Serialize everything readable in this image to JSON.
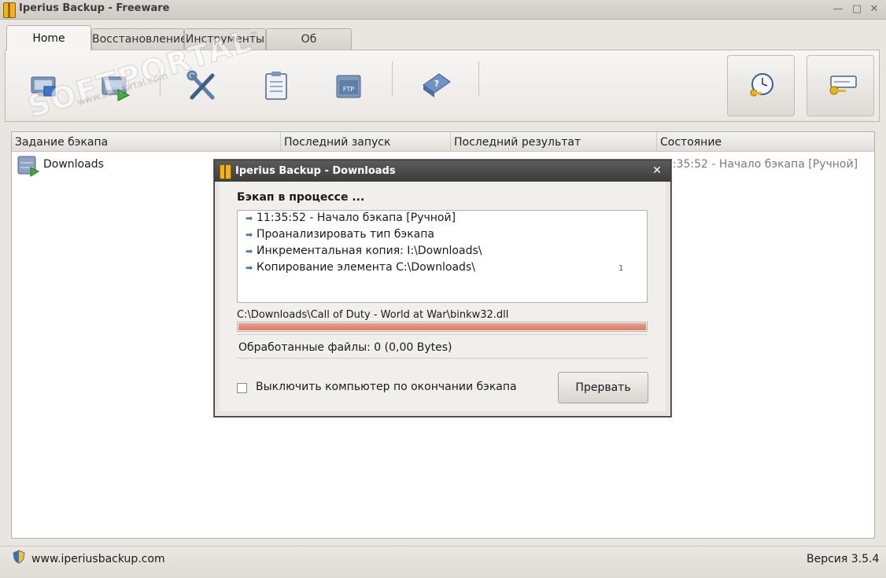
{
  "window": {
    "title": "Iperius Backup - Freeware",
    "minimize": "—",
    "maximize": "□",
    "close": "✕"
  },
  "tabs": [
    {
      "label": "Home"
    },
    {
      "label": "Восстановление"
    },
    {
      "label": "Инструменты"
    },
    {
      "label": "Об"
    }
  ],
  "ribbon": {
    "icons": [
      "new-backup-icon",
      "run-backup-icon",
      "tools-icon",
      "clipboard-icon",
      "ftp-icon",
      "help-book-icon"
    ],
    "ftp_label": "FTP",
    "big_buttons": [
      "scheduler-clock-icon",
      "license-key-icon"
    ]
  },
  "table": {
    "columns": [
      "Задание бэкапа",
      "Последний запуск",
      "Последний результат",
      "Состояние"
    ],
    "rows": [
      {
        "name": "Downloads",
        "status": "11:35:52 - Начало бэкапа [Ручной]"
      }
    ]
  },
  "statusbar": {
    "url": "www.iperiusbackup.com",
    "version": "Версия 3.5.4"
  },
  "dialog": {
    "title": "Iperius Backup  -  Downloads",
    "close": "✕",
    "heading": "Бэкап в процессе ...",
    "log": [
      "11:35:52 - Начало бэкапа [Ручной]",
      "Проанализировать тип бэкапа",
      "Инкрементальная копия: I:\\Downloads\\",
      "Копирование элемента C:\\Downloads\\"
    ],
    "log_counter": "1",
    "current_file": "C:\\Downloads\\Call of Duty - World at War\\binkw32.dll",
    "progress": 1.0,
    "processed": "Обработанные файлы: 0 (0,00 Bytes)",
    "shutdown_label": "Выключить компьютер по окончании бэкапа",
    "shutdown_checked": false,
    "abort_label": "Прервать"
  },
  "watermark": {
    "text": "SOFTPORTAL",
    "sub": "www.softportal.com",
    "tm": "™"
  },
  "colors": {
    "progress": "#d97a66",
    "dialog_title": "#3d3d3d",
    "log_arrow": "#3b6fb6"
  }
}
